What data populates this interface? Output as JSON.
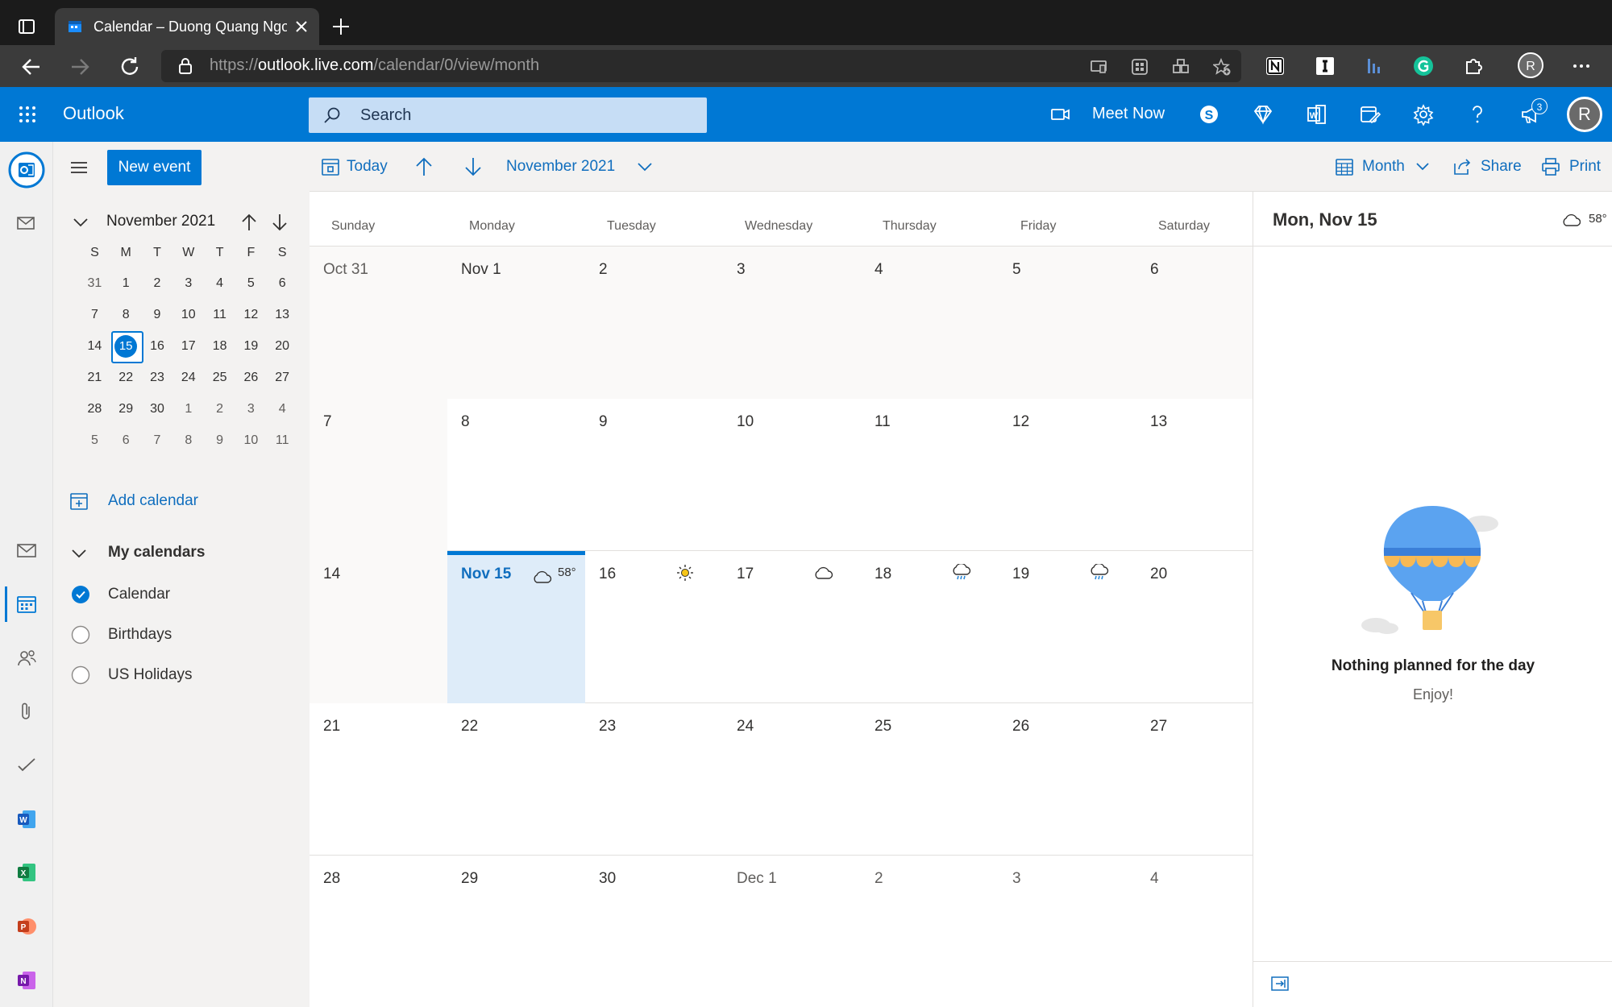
{
  "browser": {
    "tab_title": "Calendar – Duong Quang Ngoc",
    "url_prefix": "https://",
    "url_host": "outlook.live.com",
    "url_path": "/calendar/0/view/month"
  },
  "header": {
    "app_name": "Outlook",
    "search_placeholder": "Search",
    "meet_now_label": "Meet Now",
    "notification_count": "3",
    "avatar_initial": "R"
  },
  "left_pane": {
    "new_event_label": "New event",
    "mini_month": {
      "title": "November 2021",
      "weekdays": [
        "S",
        "M",
        "T",
        "W",
        "T",
        "F",
        "S"
      ],
      "weeks": [
        [
          "31",
          "1",
          "2",
          "3",
          "4",
          "5",
          "6"
        ],
        [
          "7",
          "8",
          "9",
          "10",
          "11",
          "12",
          "13"
        ],
        [
          "14",
          "15",
          "16",
          "17",
          "18",
          "19",
          "20"
        ],
        [
          "21",
          "22",
          "23",
          "24",
          "25",
          "26",
          "27"
        ],
        [
          "28",
          "29",
          "30",
          "1",
          "2",
          "3",
          "4"
        ],
        [
          "5",
          "6",
          "7",
          "8",
          "9",
          "10",
          "11"
        ]
      ],
      "today": "15"
    },
    "add_calendar_label": "Add calendar",
    "my_calendars_label": "My calendars",
    "calendars": [
      {
        "name": "Calendar",
        "checked": true
      },
      {
        "name": "Birthdays",
        "checked": false
      },
      {
        "name": "US Holidays",
        "checked": false
      }
    ]
  },
  "command_bar": {
    "today_label": "Today",
    "month_title": "November 2021",
    "view_label": "Month",
    "share_label": "Share",
    "print_label": "Print"
  },
  "calendar": {
    "weekdays": [
      "Sunday",
      "Monday",
      "Tuesday",
      "Wednesday",
      "Thursday",
      "Friday",
      "Saturday"
    ],
    "weeks": [
      [
        "Oct 31",
        "Nov 1",
        "2",
        "3",
        "4",
        "5",
        "6"
      ],
      [
        "7",
        "8",
        "9",
        "10",
        "11",
        "12",
        "13"
      ],
      [
        "14",
        "Nov 15",
        "16",
        "17",
        "18",
        "19",
        "20"
      ],
      [
        "21",
        "22",
        "23",
        "24",
        "25",
        "26",
        "27"
      ],
      [
        "28",
        "29",
        "30",
        "Dec 1",
        "2",
        "3",
        "4"
      ]
    ],
    "today_temp": "58°",
    "weather_icons": {
      "Nov 15": "cloud-icon",
      "16": "sun-icon",
      "17": "cloud-icon",
      "18": "rain-cloud-icon",
      "19": "rain-cloud-icon"
    }
  },
  "day_pane": {
    "title": "Mon, Nov 15",
    "temp": "58°",
    "empty_message": "Nothing planned for the day",
    "empty_sub": "Enjoy!"
  },
  "colors": {
    "accent": "#0078d4",
    "today_bg": "#deecf9"
  }
}
